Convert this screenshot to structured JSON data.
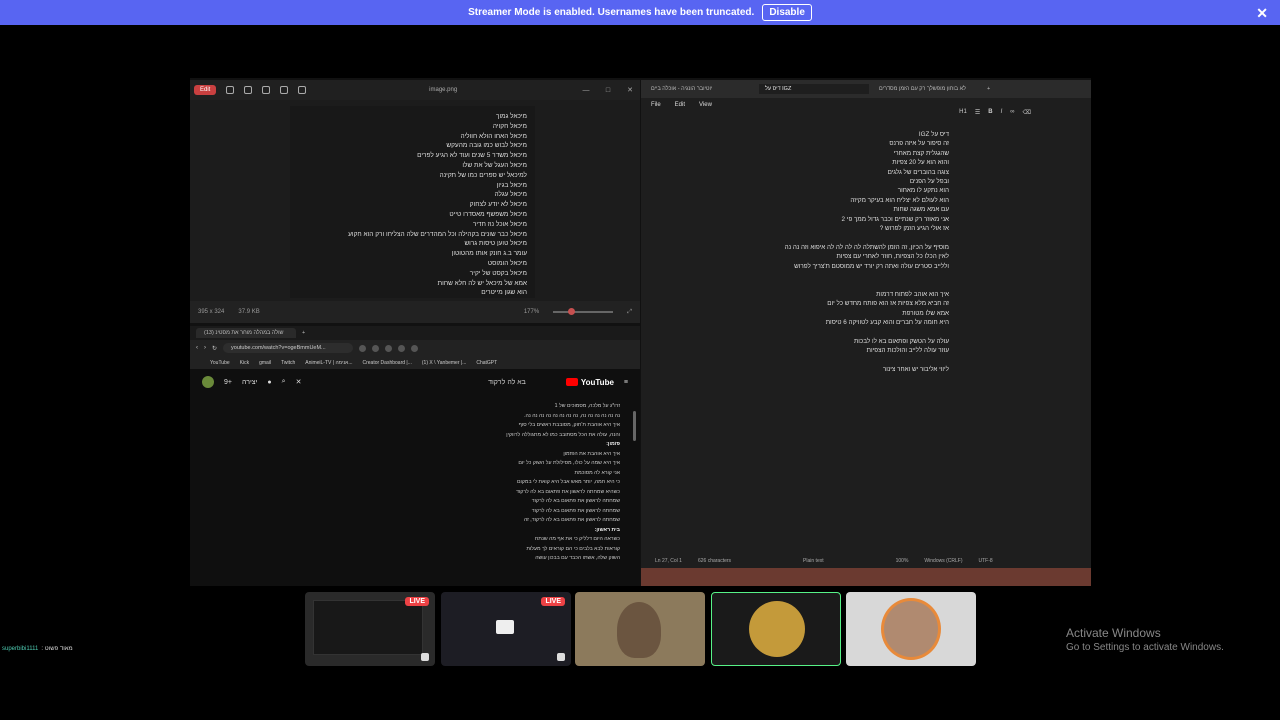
{
  "banner": {
    "message": "Streamer Mode is enabled. Usernames have been truncated.",
    "disable_label": "Disable"
  },
  "viewer": {
    "edit_label": "Edit",
    "title": "image.png",
    "lines": [
      "מיכאל גמוך",
      "מיכאל חקויה",
      "מיכאל האחו הולא חווליה",
      "מיכאל לבוש כמו גובה מהעקש",
      "מיכאל משדר 5 שנים ועוד לא הגיע לפרים",
      "מיכאל העגל של את שלו",
      "למיכאל יש ספרים כמו של תקינה",
      "מיכאל בגיון",
      "מיכאל עגלה",
      "מיכאל לא יודע לצחוק",
      "מיכאל משפשף מאסדרו טייט",
      "מיכאל אוכל נוז חדיר",
      "מיכאל כבר שונים בקהילה וכל המהדרים שלה הצליחו ורק הוא חקוע",
      "מיכאל טוען טיסות גרוש",
      "עומר ב.ג חונק אותו מהטוטון",
      "מיכאל הומוסט",
      "מיכאל בקסט של יקיר",
      "אמא של מיכאל יש לה חלא שחות",
      "הוא שגון מייטרים"
    ],
    "zoom": "177%",
    "dims": "395 x 324",
    "size": "37.9 KB"
  },
  "browser": {
    "tab1": "(13) שולה במהלה מוחר את מסטינ",
    "url": "youtube.com/watch?v=ogeBmmUeM...",
    "bookmarks": [
      "YouTube",
      "Kick",
      "gmail",
      "Twitch",
      "AnimeiL-TV | אנימה...",
      "Creator Dashboard |...",
      "(1) X \\ Yanbemer |...",
      "ChatGPT"
    ],
    "yt_logo": "YouTube",
    "search_text": "בא לה לרקוד",
    "create_label": "יצירה",
    "notif_count": "9+",
    "description": [
      "זרו*ג על מלכה, מסמוכים של 1",
      "נה נה נה נה נה נה, נה נה נה נה נה נה נה נה.",
      "איך היא אוהבת ת'חוק, מסובבת ראשים בלי סוף",
      "והנה, עולה את הכל מסתובב כמו לא מתגוללה לרווקין",
      "",
      "פזמון:",
      "איך היא אוהבת את הפזמון",
      "איך היא שמה על כולו, מסילולת על השוק כל יום",
      "אני קורא לה מסוכמת",
      "כי היא חמה, יותר מאש אבל היא קואת לי במקום",
      "כשהיא שמחתה לראשון את פתאום בא לה לרקוד",
      "שמחתה לראשון את פתאום בא לה לרקוד",
      "שמחתה לראשון את פתאום בא לה לרקוד",
      "שמחתה לראשון את פתאום בא לה לרקוד, זה",
      "",
      "בית ראשון:",
      "כשראה היום דלליק כי את אף מה שנתח",
      "קוראות לבא בלבים כי הם קוראים לך מעלות",
      "השוק שלה, אשתו הכבד עם בבכון עושה"
    ]
  },
  "notepad": {
    "tabs": [
      "יוטיובר הונגיה - אוכלה ביים",
      "דיס על IGZ",
      "לא בוחון מופשלך רק עם הזמן מסדרים"
    ],
    "menu": [
      "File",
      "Edit",
      "View"
    ],
    "heading_level": "H1",
    "lines": [
      "דיס על IGZ",
      "זה סיפור על איזה פרנס",
      "שהגגלית קצת מאחרי",
      "והוא הוא על 20 צפיות",
      "צוגה בהוברים של גלגים",
      "ובפל על הפנים",
      "הוא נתקע לו מאחור",
      "הוא לעולם לא יצליח הוא בעיקר מקיזה",
      "עם אמא משגה שחות",
      "אני מאוזר רק שנתיים וכבר גדול ממך פי 2",
      "אז אולי הגיע הזמן לפרוש ?",
      "",
      "מוסיף על הכיון, זה הזמן להשתלה לה לה לה לה איפוא וזה נה נה",
      "לאין הכלו כל הצפיות, חוזר לאחרי עם צפיות",
      "וללייב סטרים עולה ואתה רק יורד יש ממוסטם ת'צריך לפרוש",
      "",
      "",
      "איך הוא אוהב לפתוח דרמות",
      "זה חביא מלא צפיות אז הוא פותח מחדש כל יום",
      "אמא שלו מטורפת",
      "היא חומה על חברים והוא קבע לטוויקה 6 טיסות",
      "",
      "עולה על הטשק ופתאום בא לו לבכות",
      "עוזר עולה ללייב והולכות הצפיות",
      "",
      "ליווי אליבור יש ואחר צינור"
    ],
    "status": {
      "position": "Ln 27, Col 1",
      "chars": "626 characters",
      "mode": "Plain text",
      "zoom": "100%",
      "eol": "Windows (CRLF)",
      "encoding": "UTF-8"
    }
  },
  "tiles": {
    "live_label": "LIVE"
  },
  "user": {
    "name": "superbibi1111",
    "suffix": ": מאוד פשוט"
  },
  "activate": {
    "line1": "Activate Windows",
    "line2": "Go to Settings to activate Windows."
  }
}
